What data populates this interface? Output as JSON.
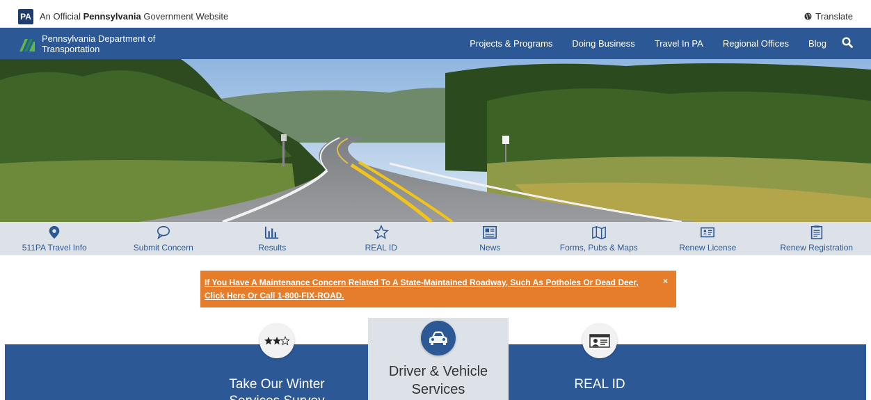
{
  "topbar": {
    "logo_text": "PA",
    "official_prefix": "An Official",
    "official_state": "Pennsylvania",
    "official_suffix": "Government Website",
    "translate_label": "Translate"
  },
  "navbar": {
    "dept_name_line1": "Pennsylvania Department of",
    "dept_name_line2": "Transportation",
    "links": [
      "Projects & Programs",
      "Doing Business",
      "Travel In PA",
      "Regional Offices",
      "Blog"
    ],
    "accent": "#2c5996"
  },
  "quicklinks": [
    {
      "label": "511PA Travel Info",
      "icon": "map-pin-icon"
    },
    {
      "label": "Submit Concern",
      "icon": "speech-bubble-icon"
    },
    {
      "label": "Results",
      "icon": "bar-chart-icon"
    },
    {
      "label": "REAL ID",
      "icon": "star-icon"
    },
    {
      "label": "News",
      "icon": "newspaper-icon"
    },
    {
      "label": "Forms, Pubs & Maps",
      "icon": "map-icon"
    },
    {
      "label": "Renew License",
      "icon": "id-card-icon"
    },
    {
      "label": "Renew Registration",
      "icon": "registration-icon"
    }
  ],
  "alert": {
    "text": "If You Have A Maintenance Concern Related To A State-Maintained Roadway, Such As Potholes Or Dead Deer, Click Here Or Call 1-800-FIX-ROAD.",
    "close": "×",
    "color": "#e57d2b"
  },
  "cards": {
    "survey_title": "Take Our Winter Services Survey",
    "driver_title": "Driver & Vehicle Services",
    "realid_title": "REAL ID"
  }
}
